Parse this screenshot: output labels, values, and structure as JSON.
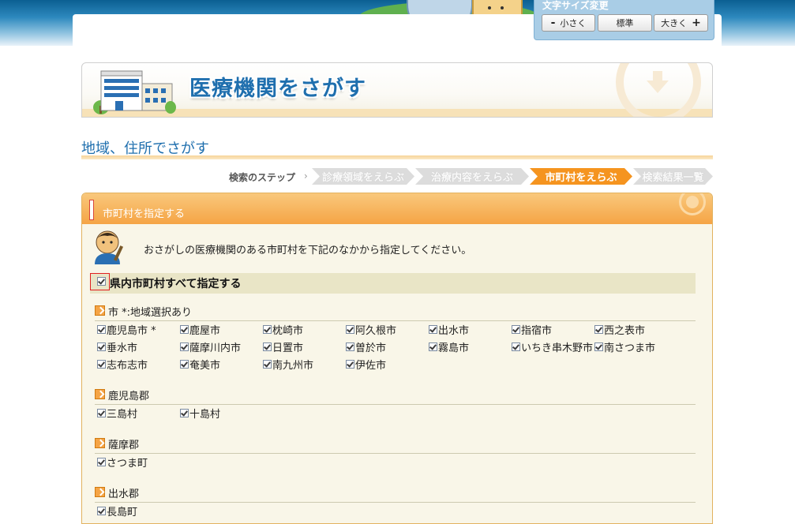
{
  "font_panel": {
    "title": "文字サイズ変更",
    "small_label": "小さく",
    "small_symbol": "-",
    "normal_label": "標準",
    "large_label": "大きく",
    "large_symbol": "+"
  },
  "header": {
    "title": "医療機関をさがす"
  },
  "subtitle": "地域、住所でさがす",
  "steps": {
    "label": "検索のステップ",
    "items": [
      "診療領域をえらぶ",
      "治療内容をえらぶ",
      "市町村をえらぶ",
      "検索結果一覧"
    ],
    "active_index": 2
  },
  "section": {
    "title": "市町村を指定する",
    "instruction": "おさがしの医療機関のある市町村を下記のなかから指定してください。",
    "select_all_label": "県内市町村すべて指定する",
    "groups": [
      {
        "title": "市 *:地域選択あり",
        "items": [
          "鹿児島市 *",
          "鹿屋市",
          "枕崎市",
          "阿久根市",
          "出水市",
          "指宿市",
          "西之表市",
          "垂水市",
          "薩摩川内市",
          "日置市",
          "曽於市",
          "霧島市",
          "いちき串木野市",
          "南さつま市",
          "志布志市",
          "奄美市",
          "南九州市",
          "伊佐市"
        ]
      },
      {
        "title": "鹿児島郡",
        "items": [
          "三島村",
          "十島村"
        ]
      },
      {
        "title": "薩摩郡",
        "items": [
          "さつま町"
        ]
      },
      {
        "title": "出水郡",
        "items": [
          "長島町"
        ]
      }
    ]
  },
  "colors": {
    "accent_orange": "#f5941f",
    "title_blue": "#1f6fae",
    "section_bg": "#f9f6e8"
  }
}
